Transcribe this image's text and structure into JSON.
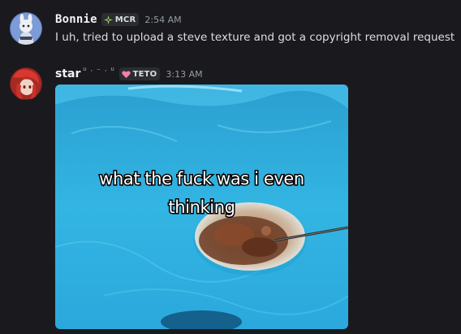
{
  "messages": [
    {
      "username": "Bonnie",
      "tag": "MCR",
      "tag_icon": "compass-star-icon",
      "tag_icon_color": "#a6d86a",
      "timestamp": "2:54 AM",
      "text": "I uh, tried to upload a steve texture and got a copyright removal request"
    },
    {
      "username": "star",
      "name_decoration": "ᵁ · ⁻ · ᵁ",
      "tag": "TETO",
      "tag_icon": "heart-icon",
      "tag_icon_color": "#f47fa8",
      "timestamp": "3:13 AM",
      "attachment": {
        "caption_line1": "what the fuck was i even",
        "caption_line2": "thinking"
      }
    }
  ],
  "colors": {
    "background": "#1a1a1e",
    "username": "#f2f3f5",
    "timestamp": "#949ba4",
    "text": "#dbdee1",
    "tag_bg": "#2b2d31",
    "water": "#2fb3e0"
  }
}
